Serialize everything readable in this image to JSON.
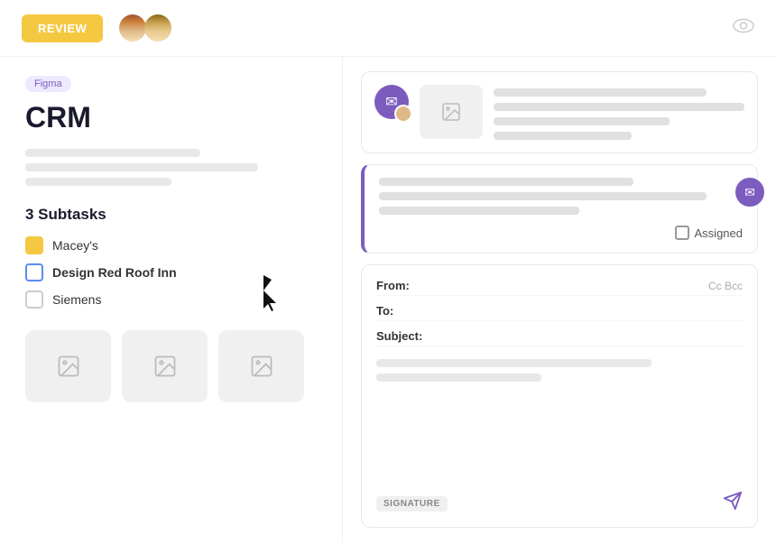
{
  "header": {
    "review_label": "REVIEW",
    "eye_icon": "👁"
  },
  "left": {
    "badge": "Figma",
    "title": "CRM",
    "subtasks_heading": "3 Subtasks",
    "subtasks": [
      {
        "id": 1,
        "label": "Macey's",
        "style": "yellow"
      },
      {
        "id": 2,
        "label": "Design Red Roof Inn",
        "style": "blue-outline"
      },
      {
        "id": 3,
        "label": "Siemens",
        "style": "gray-outline"
      }
    ]
  },
  "right": {
    "card2_assigned_label": "Assigned",
    "compose": {
      "from_label": "From:",
      "to_label": "To:",
      "subject_label": "Subject:",
      "cc_label": "Cc Bcc",
      "signature_label": "SIGNATURE"
    }
  }
}
